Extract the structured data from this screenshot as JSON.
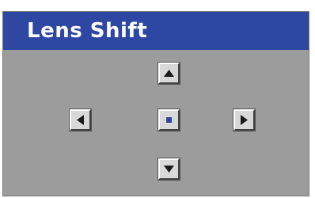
{
  "window": {
    "title": "Lens Shift"
  },
  "controls": {
    "up": {
      "icon": "triangle-up-icon"
    },
    "left": {
      "icon": "triangle-left-icon"
    },
    "center": {
      "icon": "center-dot-icon",
      "selected": true
    },
    "right": {
      "icon": "triangle-right-icon"
    },
    "down": {
      "icon": "triangle-down-icon"
    }
  },
  "colors": {
    "title_bar": "#2e47a2",
    "panel": "#9c9c9c",
    "button_face": "#d8d8d8",
    "glyph": "#1a1a1a",
    "selected_dot": "#2e47a2"
  }
}
